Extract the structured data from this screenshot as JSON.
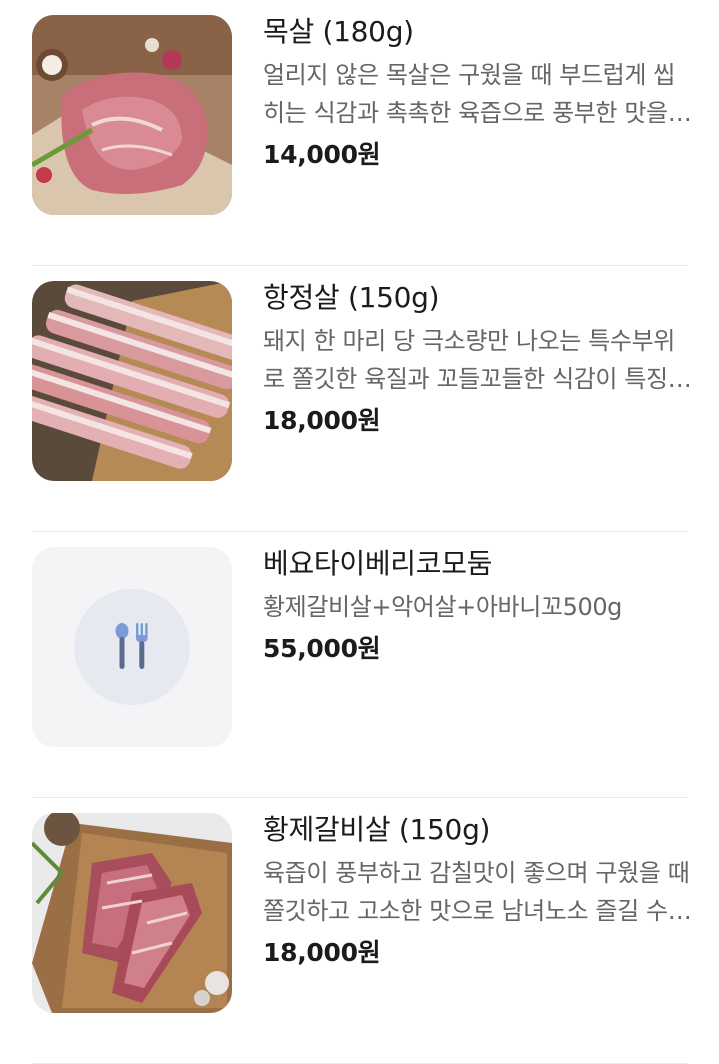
{
  "menu": {
    "items": [
      {
        "name": "목살 (180g)",
        "description": "얼리지 않은 목살은 구웠을 때 부드럽게 씹히는 식감과 촉촉한 육즙으로 풍부한 맛을 선사합니다.",
        "price": "14,000원",
        "image": "pork-neck-photo"
      },
      {
        "name": "항정살 (150g)",
        "description": "돼지 한 마리 당 극소량만 나오는 특수부위로 쫄깃한 육질과 꼬들꼬들한 식감이 특징입니다.",
        "price": "18,000원",
        "image": "pork-jowl-photo"
      },
      {
        "name": "베요타이베리코모둠",
        "description": "황제갈비살+악어살+아바니꼬500g",
        "price": "55,000원",
        "image": "utensils-icon"
      },
      {
        "name": "황제갈비살 (150g)",
        "description": "육즙이 풍부하고 감칠맛이 좋으며 구웠을 때 쫄깃하고 고소한 맛으로 남녀노소 즐길 수 있습니다.",
        "price": "18,000원",
        "image": "pork-rib-photo"
      }
    ]
  }
}
